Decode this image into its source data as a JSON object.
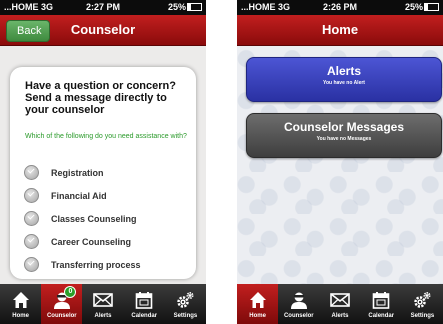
{
  "left_screen": {
    "status_bar": {
      "carrier": "...HOME  3G",
      "time": "2:27 PM",
      "battery": "25%"
    },
    "nav": {
      "back_label": "Back",
      "title": "Counselor"
    },
    "card": {
      "heading": "Have a question or concern? Send a message directly to your counselor",
      "prompt": "Which of the following do you need assistance with?",
      "options": [
        {
          "label": "Registration"
        },
        {
          "label": "Financial Aid"
        },
        {
          "label": "Classes Counseling"
        },
        {
          "label": "Career Counseling"
        },
        {
          "label": "Transferring process"
        }
      ]
    },
    "tabbar": {
      "active_tab": "Counselor",
      "counselor_badge": "0",
      "tabs": [
        {
          "label": "Home",
          "icon": "home-icon"
        },
        {
          "label": "Counselor",
          "icon": "counselor-icon"
        },
        {
          "label": "Alerts",
          "icon": "envelope-icon"
        },
        {
          "label": "Calendar",
          "icon": "calendar-icon"
        },
        {
          "label": "Settings",
          "icon": "gear-icon"
        }
      ]
    }
  },
  "right_screen": {
    "status_bar": {
      "carrier": "...HOME  3G",
      "time": "2:26 PM",
      "battery": "25%"
    },
    "nav": {
      "title": "Home"
    },
    "alerts_card": {
      "title": "Alerts",
      "subtitle": "You have no Alert"
    },
    "counselor_card": {
      "title": "Counselor Messages",
      "subtitle": "You have no Messages"
    },
    "tabbar": {
      "active_tab": "Home",
      "tabs": [
        {
          "label": "Home",
          "icon": "home-icon"
        },
        {
          "label": "Counselor",
          "icon": "counselor-icon"
        },
        {
          "label": "Alerts",
          "icon": "envelope-icon"
        },
        {
          "label": "Calendar",
          "icon": "calendar-icon"
        },
        {
          "label": "Settings",
          "icon": "gear-icon"
        }
      ]
    }
  },
  "colors": {
    "nav_red": "#a81515",
    "back_green": "#4e9e4e",
    "alerts_blue": "#3a42c0",
    "counselor_gray": "#555555",
    "prompt_green": "#2a9a2a"
  }
}
